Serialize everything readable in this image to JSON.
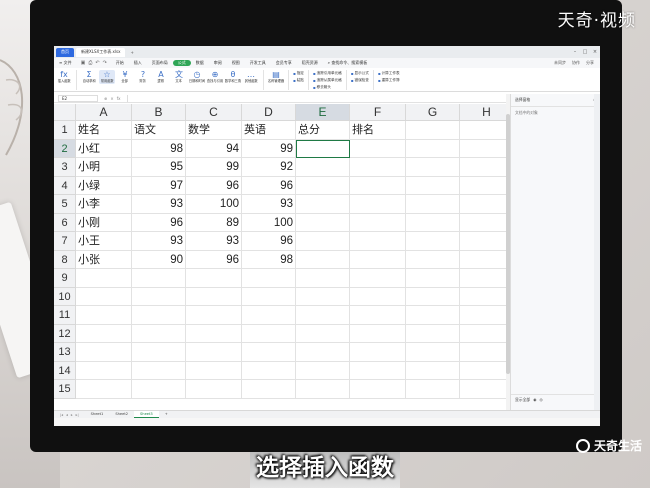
{
  "watermark_top": "天奇·视频",
  "watermark_bottom": "天奇生活",
  "subtitle": "选择插入函数",
  "tabs": {
    "home": "首页",
    "doc": "新建XLSX工作表.xlsx",
    "add": "+"
  },
  "menu": {
    "file": "≡ 文件",
    "items": [
      "开始",
      "插入",
      "页面布局",
      "公式",
      "数据",
      "审阅",
      "视图",
      "开发工具",
      "会员专享",
      "稻壳资源"
    ],
    "active_index": 3,
    "search": "查找命令、搜索模板",
    "right": [
      "未同步",
      "协作",
      "分享"
    ]
  },
  "ribbon": {
    "buttons": [
      {
        "icon": "fx",
        "label": "插入函数",
        "highlight": false
      },
      {
        "icon": "Σ",
        "label": "自动求和",
        "highlight": false
      },
      {
        "icon": "☆",
        "label": "常用函数",
        "highlight": true
      },
      {
        "icon": "¥",
        "label": "全部",
        "highlight": false
      },
      {
        "icon": "?",
        "label": "财务",
        "highlight": false
      },
      {
        "icon": "A",
        "label": "逻辑",
        "highlight": false
      },
      {
        "icon": "文",
        "label": "文本",
        "highlight": false
      },
      {
        "icon": "◷",
        "label": "日期和时间",
        "highlight": false
      },
      {
        "icon": "⊕",
        "label": "查找与引用",
        "highlight": false
      },
      {
        "icon": "θ",
        "label": "数学和三角",
        "highlight": false
      },
      {
        "icon": "…",
        "label": "其他函数",
        "highlight": false
      },
      {
        "icon": "▤",
        "label": "名称管理器",
        "highlight": false
      }
    ],
    "small_groups": [
      [
        "指定",
        "粘贴"
      ],
      [
        "追踪引用单元格",
        "追踪从属单元格",
        "移去箭头"
      ],
      [
        "显示公式",
        "错误检查"
      ],
      [
        "计算工作表",
        "重算工作簿"
      ]
    ]
  },
  "formula_bar": {
    "cell_ref": "E2",
    "icons": [
      "⊕",
      "×",
      "fx"
    ]
  },
  "grid": {
    "columns": [
      "A",
      "B",
      "C",
      "D",
      "E",
      "F",
      "G",
      "H"
    ],
    "selected_column": "E",
    "selected_row": "2",
    "row_numbers": [
      "1",
      "2",
      "3",
      "4",
      "5",
      "6",
      "7",
      "8",
      "9",
      "10",
      "11",
      "12",
      "13",
      "14",
      "15"
    ],
    "rows": [
      [
        "姓名",
        "语文",
        "数学",
        "英语",
        "总分",
        "排名",
        "",
        ""
      ],
      [
        "小红",
        "98",
        "94",
        "99",
        "",
        "",
        "",
        ""
      ],
      [
        "小明",
        "95",
        "99",
        "92",
        "",
        "",
        "",
        ""
      ],
      [
        "小绿",
        "97",
        "96",
        "96",
        "",
        "",
        "",
        ""
      ],
      [
        "小李",
        "93",
        "100",
        "93",
        "",
        "",
        "",
        ""
      ],
      [
        "小刚",
        "96",
        "89",
        "100",
        "",
        "",
        "",
        ""
      ],
      [
        "小王",
        "93",
        "93",
        "96",
        "",
        "",
        "",
        ""
      ],
      [
        "小张",
        "90",
        "96",
        "98",
        "",
        "",
        "",
        ""
      ],
      [
        "",
        "",
        "",
        "",
        "",
        "",
        "",
        ""
      ],
      [
        "",
        "",
        "",
        "",
        "",
        "",
        "",
        ""
      ],
      [
        "",
        "",
        "",
        "",
        "",
        "",
        "",
        ""
      ],
      [
        "",
        "",
        "",
        "",
        "",
        "",
        "",
        ""
      ],
      [
        "",
        "",
        "",
        "",
        "",
        "",
        "",
        ""
      ],
      [
        "",
        "",
        "",
        "",
        "",
        "",
        "",
        ""
      ],
      [
        "",
        "",
        "",
        "",
        "",
        "",
        "",
        ""
      ]
    ]
  },
  "sheets": {
    "tabs": [
      "Sheet1",
      "Sheet2",
      "Sheet3"
    ],
    "active_index": 2,
    "add": "+"
  },
  "side_panel": {
    "title": "选择窗格",
    "subtitle": "文档中的对象",
    "footer": [
      "显示全部",
      "◉",
      "◎"
    ]
  },
  "colors": {
    "accent_green": "#1f7a45",
    "tab_blue": "#2f6ae0",
    "monitor_bezel": "#101010"
  }
}
